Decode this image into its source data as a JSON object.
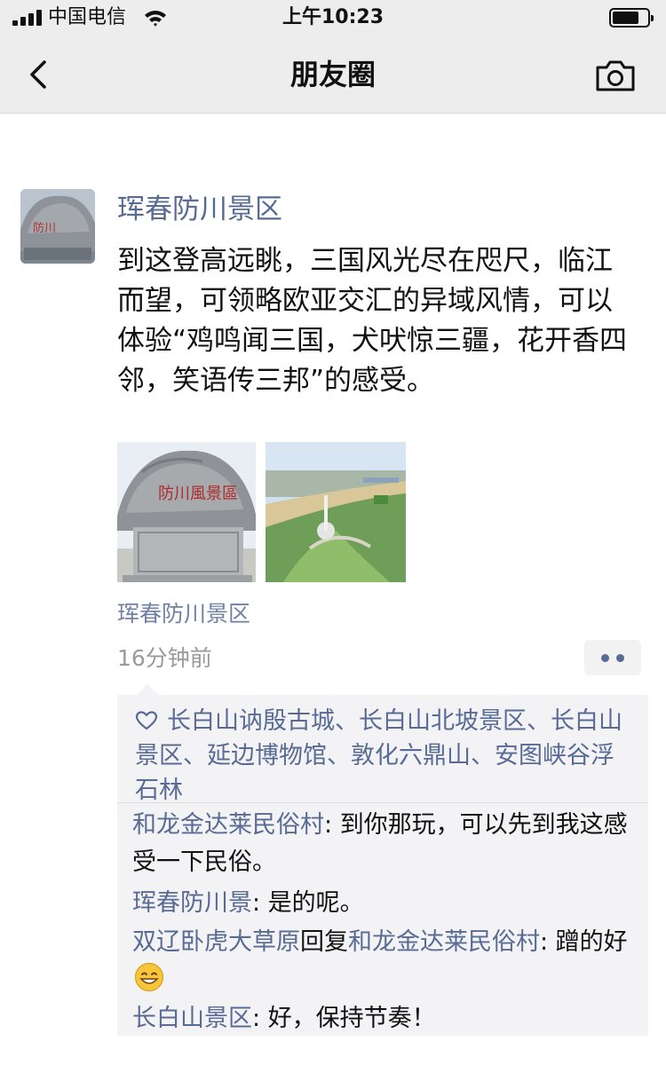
{
  "status_bar": {
    "carrier": "中国电信",
    "time": "上午10:23"
  },
  "nav": {
    "title": "朋友圈",
    "back_icon": "chevron-left-icon",
    "camera_icon": "camera-icon"
  },
  "post": {
    "author": "珲春防川景区",
    "content": "到这登高远眺，三国风光尽在咫尺，临江而望，可领略欧亚交汇的异域风情，可以体验“鸡鸣闻三国，犬吠惊三疆，花开香四邻，笑语传三邦”的感受。",
    "photos": [
      {
        "icon": "photo-stone-monument"
      },
      {
        "icon": "photo-river-aerial"
      }
    ],
    "location": "珲春防川景区",
    "time_ago": "16分钟前",
    "more_icon": "more-dots-icon"
  },
  "likes": {
    "icon": "heart-icon",
    "names": "长白山讷殷古城、长白山北坡景区、长白山景区、延边博物馆、敦化六鼎山、安图峡谷浮石林"
  },
  "comments": [
    {
      "name": "和龙金达莱民俗村",
      "sep": ": ",
      "text": "到你那玩，可以先到我这感受一下民俗。"
    },
    {
      "name": "珲春防川景",
      "sep": ": ",
      "text": "是的呢。"
    },
    {
      "name": "双辽卧虎大草原",
      "reply_word": "回复",
      "reply_to": "和龙金达莱民俗村",
      "sep": ": ",
      "text": "蹭的好"
    },
    {
      "name": "长白山景区",
      "sep": ": ",
      "text": "好，保持节奏！"
    }
  ],
  "colors": {
    "link": "#576b95",
    "header_bg": "#ededed",
    "comment_bg": "#f3f3f5"
  }
}
